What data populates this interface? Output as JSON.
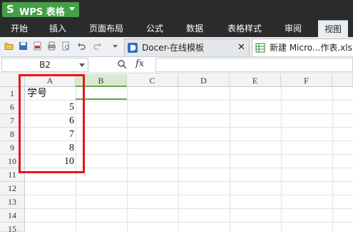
{
  "app": {
    "logo": "S",
    "name": "WPS 表格"
  },
  "tabs": [
    "开始",
    "插入",
    "页面布局",
    "公式",
    "数据",
    "表格样式",
    "审阅",
    "视图"
  ],
  "active_tab_index": 7,
  "doc_tabs": [
    {
      "label": "Docer-在线模板",
      "active": false
    },
    {
      "label": "新建 Micro...作表.xls",
      "active": true
    }
  ],
  "formula_bar": {
    "cell_ref": "B2",
    "fx": "fx",
    "value": ""
  },
  "grid": {
    "columns": [
      "A",
      "B",
      "C",
      "D",
      "E",
      "F"
    ],
    "selected_column": "B",
    "rows": [
      "1",
      "6",
      "7",
      "8",
      "9",
      "10",
      "11",
      "12",
      "13",
      "14",
      "15"
    ],
    "cells": {
      "A1": "学号",
      "A6": "5",
      "A7": "6",
      "A8": "7",
      "A9": "8",
      "A10": "10"
    }
  },
  "colors": {
    "accent": "#43a047",
    "highlight": "#e8141b",
    "selection": "#6aa84f"
  }
}
